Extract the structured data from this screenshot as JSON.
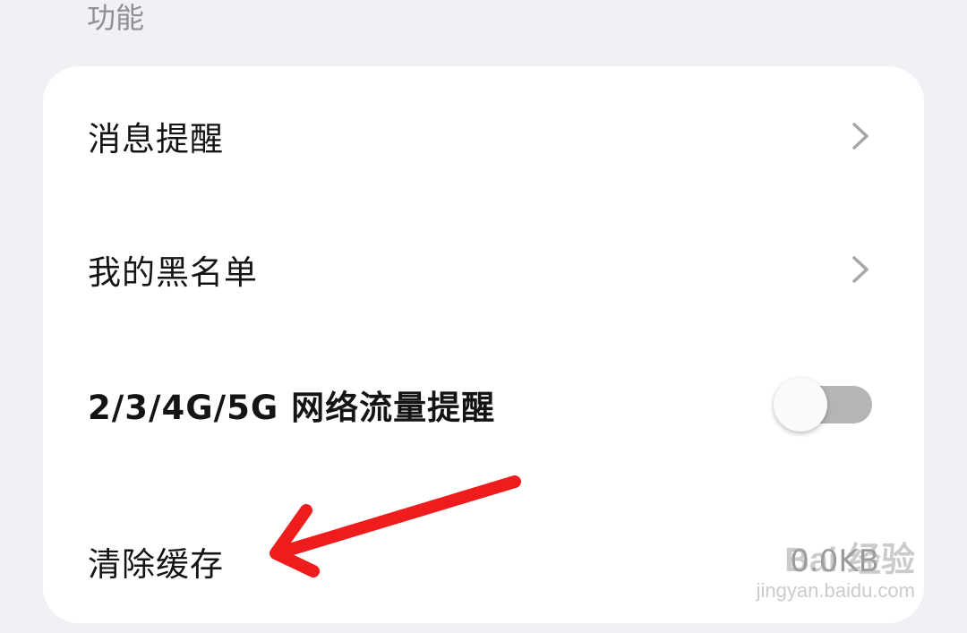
{
  "section": {
    "title": "功能"
  },
  "items": [
    {
      "label": "消息提醒",
      "control": "chevron-right-icon"
    },
    {
      "label": "我的黑名单",
      "control": "chevron-right-icon"
    },
    {
      "label": "2/3/4G/5G 网络流量提醒",
      "control": "toggle",
      "toggle_on": false
    },
    {
      "label": "清除缓存",
      "value": "0.0KB"
    }
  ],
  "annotation": {
    "type": "arrow-icon",
    "color": "#ee1c1c",
    "points_to": "清除缓存"
  },
  "watermark": {
    "main": "Bai 经验",
    "sub": "jingyan.baidu.com"
  },
  "colors": {
    "background": "#f1f0f5",
    "card": "#ffffff",
    "toggle_track": "#b5b5b5",
    "text": "#141414",
    "muted": "#8f8f94"
  }
}
